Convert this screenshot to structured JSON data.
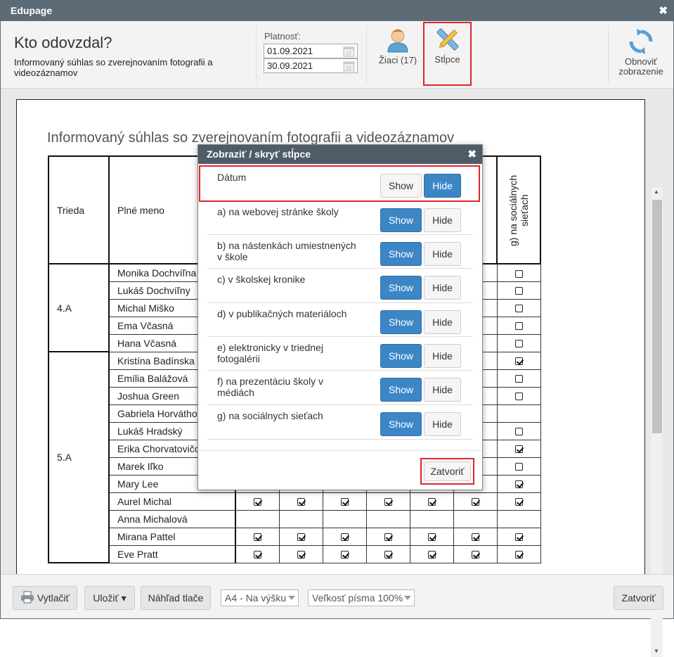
{
  "window": {
    "title": "Edupage"
  },
  "header": {
    "title": "Kto odovzdal?",
    "subtitle": "Informovaný súhlas so zverejnovaním fotografii a videozáznamov",
    "validity_label": "Platnosť:",
    "date_from": "01.09.2021",
    "date_to": "30.09.2021",
    "students_label": "Žiaci (17)",
    "columns_label": "Stĺpce",
    "refresh_label": "Obnoviť zobrazenie"
  },
  "report": {
    "title": "Informovaný súhlas so zverejnovaním fotografii a videozáznamov",
    "col_class": "Trieda",
    "col_name": "Plné meno",
    "col_g": "g) na sociálnych sieťach",
    "classes": [
      {
        "name": "4.A"
      },
      {
        "name": "5.A"
      }
    ],
    "rows": [
      {
        "name": "Monika Dochvíľna",
        "cells": [
          0,
          0,
          0,
          0,
          0,
          0,
          0
        ]
      },
      {
        "name": "Lukáš Dochvíľny",
        "cells": [
          0,
          0,
          0,
          0,
          0,
          0,
          0
        ]
      },
      {
        "name": "Michal Miško",
        "cells": [
          0,
          0,
          0,
          0,
          0,
          0,
          0
        ]
      },
      {
        "name": "Ema Včasná",
        "cells": [
          0,
          0,
          0,
          0,
          0,
          0,
          0
        ]
      },
      {
        "name": "Hana Včasná",
        "cells": [
          0,
          0,
          0,
          0,
          0,
          0,
          0
        ]
      },
      {
        "name": "Kristína Badínska",
        "cells": [
          1,
          1,
          1,
          1,
          1,
          1,
          1
        ]
      },
      {
        "name": "Emília Balážová",
        "cells": [
          0,
          0,
          0,
          0,
          0,
          0,
          0
        ]
      },
      {
        "name": "Joshua Green",
        "cells": [
          0,
          0,
          0,
          0,
          0,
          0,
          0
        ]
      },
      {
        "name": "Gabriela Horváthová",
        "cells": [
          -1,
          -1,
          -1,
          -1,
          -1,
          -1,
          -1
        ]
      },
      {
        "name": "Lukáš Hradský",
        "cells": [
          0,
          0,
          0,
          0,
          0,
          0,
          0
        ]
      },
      {
        "name": "Erika Chorvatovičová",
        "cells": [
          1,
          1,
          1,
          1,
          1,
          1,
          1
        ]
      },
      {
        "name": "Marek Iľko",
        "cells": [
          0,
          0,
          0,
          0,
          0,
          0,
          0
        ]
      },
      {
        "name": "Mary Lee",
        "cells": [
          1,
          1,
          1,
          1,
          1,
          1,
          1
        ]
      },
      {
        "name": "Aurel Michal",
        "cells": [
          1,
          1,
          1,
          1,
          1,
          1,
          1
        ]
      },
      {
        "name": "Anna Michalová",
        "cells": [
          -1,
          -1,
          -1,
          -1,
          -1,
          -1,
          -1
        ]
      },
      {
        "name": "Mirana Pattel",
        "cells": [
          1,
          1,
          1,
          1,
          1,
          1,
          1
        ]
      },
      {
        "name": "Eve Pratt",
        "cells": [
          1,
          1,
          1,
          1,
          1,
          1,
          1
        ]
      }
    ]
  },
  "modal": {
    "title": "Zobraziť / skryť stĺpce",
    "show_label": "Show",
    "hide_label": "Hide",
    "close_label": "Zatvoriť",
    "rows": [
      {
        "label": "Dátum",
        "state": "hide"
      },
      {
        "label": "a) na webovej stránke školy",
        "state": "show"
      },
      {
        "label": "b) na nástenkách umiestnených v škole",
        "state": "show"
      },
      {
        "label": "c) v školskej kronike",
        "state": "show"
      },
      {
        "label": "d) v publikačných materiáloch",
        "state": "show"
      },
      {
        "label": "e) elektronicky v triednej fotogalérii",
        "state": "show"
      },
      {
        "label": "f) na prezentáciu školy v médiách",
        "state": "show"
      },
      {
        "label": "g) na sociálnych sieťach",
        "state": "show"
      }
    ]
  },
  "footer": {
    "print_label": "Vytlačiť",
    "save_label": "Uložiť ▾",
    "preview_label": "Náhľad tlače",
    "paper_select": "A4 - Na výšku",
    "font_select": "Veľkosť písma 100%",
    "close_label": "Zatvoriť"
  },
  "colors": {
    "titlebar": "#5d6b76",
    "accent": "#3d86c6",
    "highlight": "#e0242b"
  }
}
